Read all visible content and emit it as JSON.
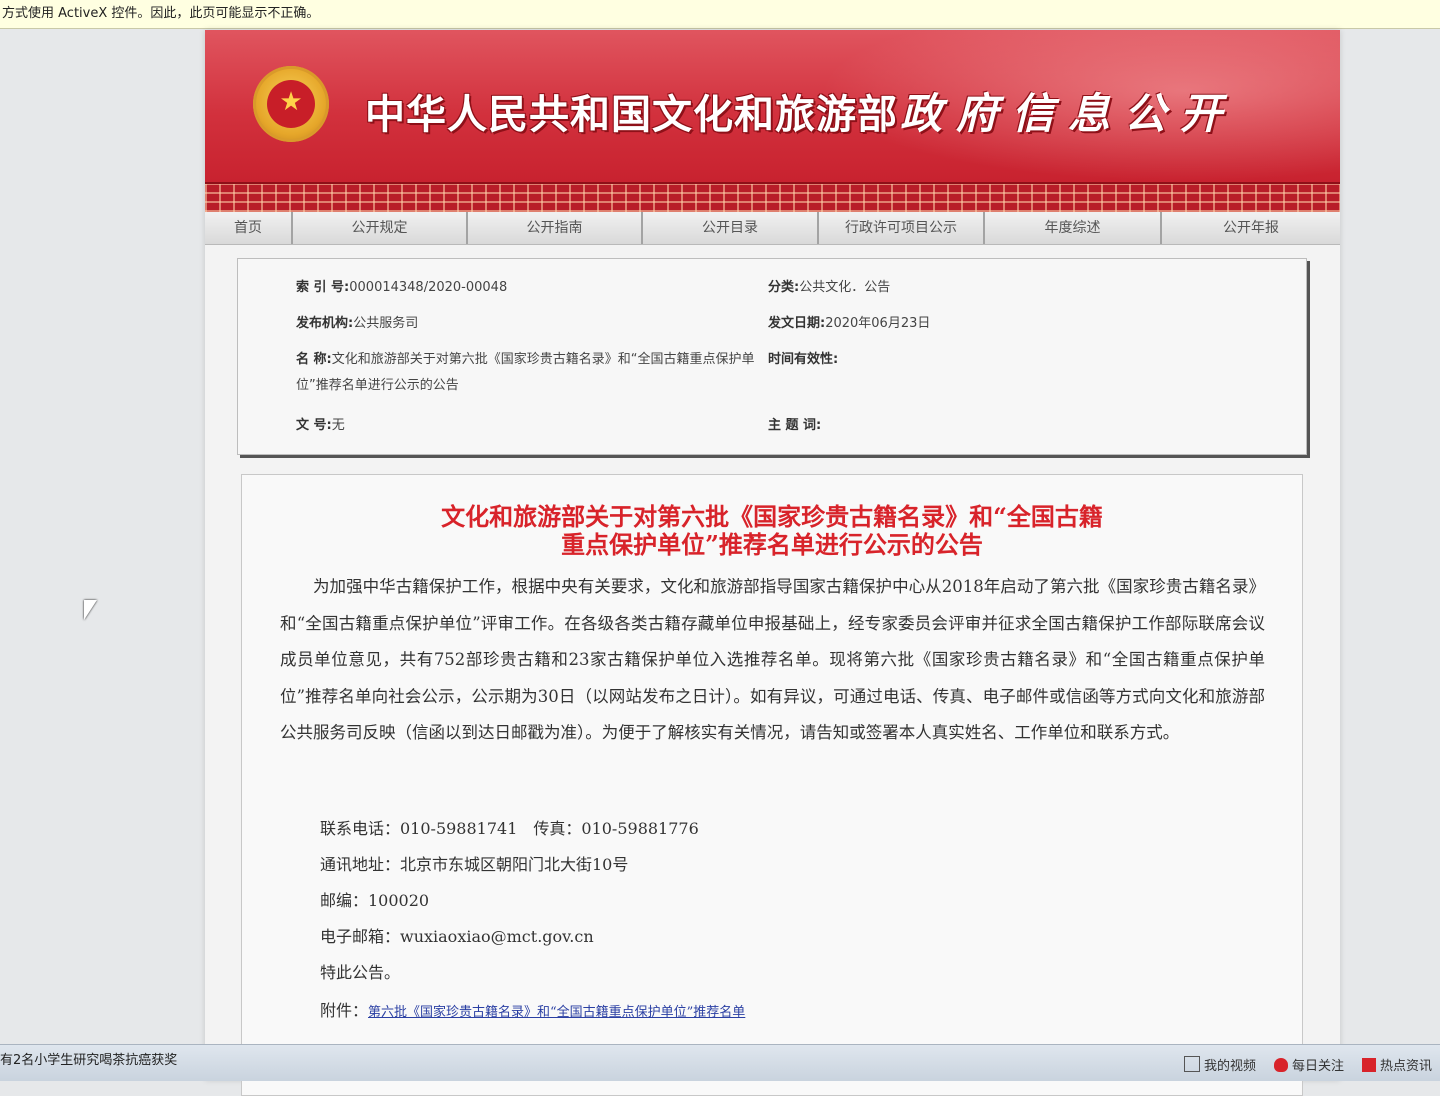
{
  "ie_warning": "方式使用 ActiveX 控件。因此，此页可能显示不正确。",
  "header": {
    "site_title": "中华人民共和国文化和旅游部",
    "site_subtitle": "政府信息公开"
  },
  "nav": {
    "items": [
      "首页",
      "公开规定",
      "公开指南",
      "公开目录",
      "行政许可项目公示",
      "年度综述",
      "公开年报"
    ]
  },
  "meta": {
    "index_label": "索 引 号:",
    "index_value": "000014348/2020-00048",
    "category_label": "分类:",
    "category_value": "公共文化．公告",
    "publisher_label": "发布机构:",
    "publisher_value": "公共服务司",
    "date_label": "发文日期:",
    "date_value": "2020年06月23日",
    "name_label": "名 称:",
    "name_value": "文化和旅游部关于对第六批《国家珍贵古籍名录》和“全国古籍重点保护单位”推荐名单进行公示的公告",
    "validity_label": "时间有效性:",
    "docno_label": "文 号:",
    "docno_value": "无",
    "keywords_label": "主 题 词:"
  },
  "article": {
    "title_line1": "文化和旅游部关于对第六批《国家珍贵古籍名录》和“全国古籍",
    "title_line2": "重点保护单位”推荐名单进行公示的公告",
    "body": "为加强中华古籍保护工作，根据中央有关要求，文化和旅游部指导国家古籍保护中心从2018年启动了第六批《国家珍贵古籍名录》和“全国古籍重点保护单位”评审工作。在各级各类古籍存藏单位申报基础上，经专家委员会评审并征求全国古籍保护工作部际联席会议成员单位意见，共有752部珍贵古籍和23家古籍保护单位入选推荐名单。现将第六批《国家珍贵古籍名录》和“全国古籍重点保护单位”推荐名单向社会公示，公示期为30日（以网站发布之日计）。如有异议，可通过电话、传真、电子邮件或信函等方式向文化和旅游部公共服务司反映（信函以到达日邮戳为准）。为便于了解核实有关情况，请告知或签署本人真实姓名、工作单位和联系方式。",
    "phone": "联系电话：010-59881741　传真：010-59881776",
    "address": "通讯地址：北京市东城区朝阳门北大街10号",
    "postcode": "邮编：100020",
    "email": "电子邮箱：wuxiaoxiao@mct.gov.cn",
    "closing": "特此公告。",
    "attachment_label": "附件：",
    "attachment_link": "第六批《国家珍贵古籍名录》和“全国古籍重点保护单位”推荐名单"
  },
  "taskbar": {
    "news": "有2名小学生研究喝茶抗癌获奖",
    "tray": [
      "我的视频",
      "每日关注",
      "热点资讯"
    ]
  },
  "colors": {
    "banner_red": "#d2313d",
    "title_red": "#d8232a",
    "link_blue": "#2a3fa3"
  }
}
